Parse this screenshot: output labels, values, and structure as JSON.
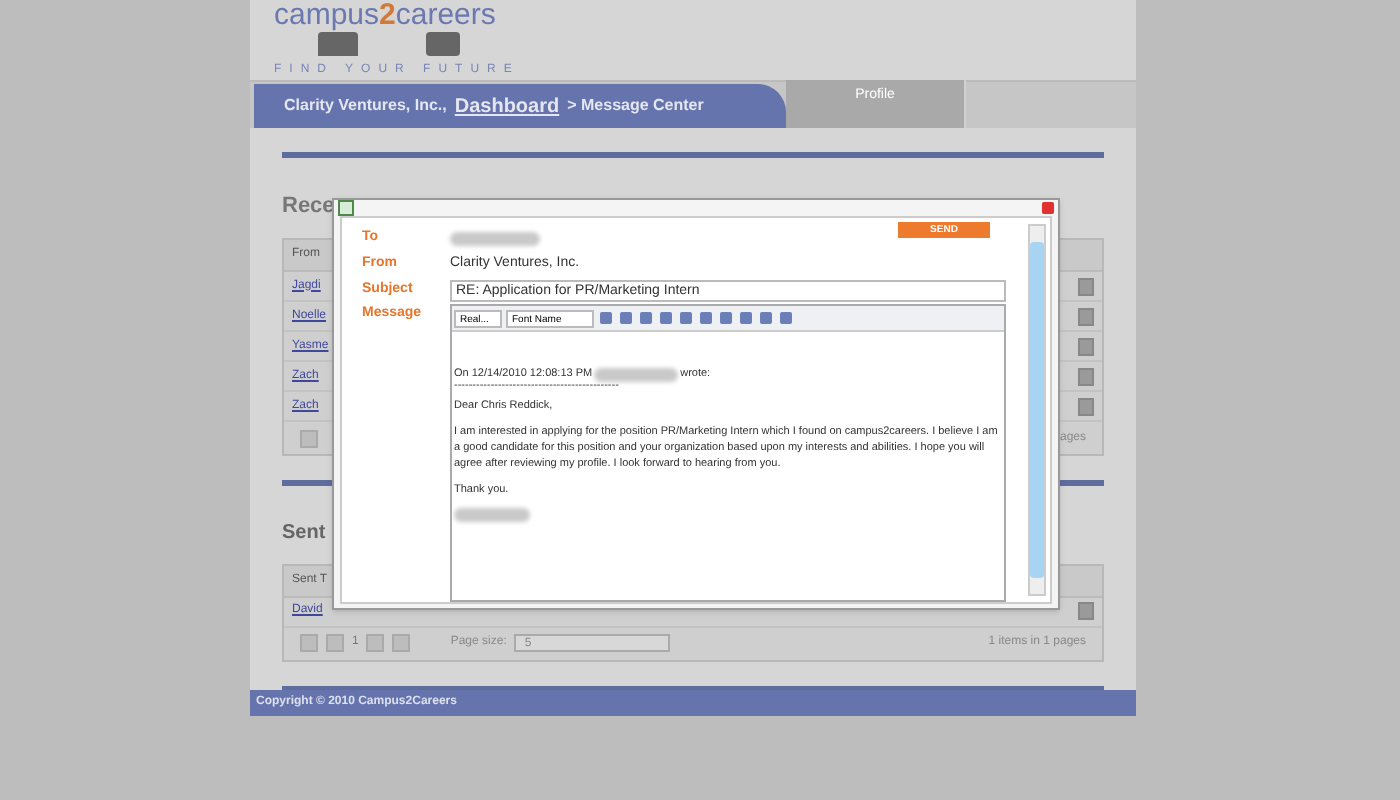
{
  "header": {
    "logo_left": "campus",
    "logo_mid": "2",
    "logo_right": "careers",
    "tagline": "FIND YOUR FUTURE"
  },
  "breadcrumb": {
    "company": "Clarity Ventures, Inc.,",
    "link": "Dashboard",
    "rest": "> Message Center"
  },
  "tabs": [
    {
      "label": "Profile",
      "selected": false
    }
  ],
  "received": {
    "heading": "Rece",
    "column": "From",
    "rows": [
      "Jagdi",
      "Noelle",
      "Yasme",
      "Zach",
      "Zach"
    ],
    "pager_tail": "ages"
  },
  "sent": {
    "heading": "Sent",
    "column": "Sent T",
    "rows": [
      "David"
    ],
    "page": "1",
    "page_size_label": "Page size:",
    "page_size": "5",
    "summary": "1 items in 1 pages"
  },
  "footer": "Copyright © 2010 Campus2Careers",
  "dialog": {
    "send": "SEND",
    "fields": [
      {
        "label": "To",
        "kind": "blurred"
      },
      {
        "label": "From",
        "kind": "text",
        "value": "Clarity Ventures, Inc."
      },
      {
        "label": "Subject",
        "kind": "input",
        "value": "RE: Application for PR/Marketing Intern"
      },
      {
        "label": "Message",
        "kind": "editor"
      }
    ],
    "toolbar": {
      "size": "Real...",
      "font": "Font Name"
    },
    "body": [
      {
        "kind": "blank"
      },
      {
        "kind": "quote",
        "text": "On 12/14/2010 12:08:13 PM",
        "tail": "wrote:"
      },
      {
        "kind": "rule",
        "text": "---------------------------------------------"
      },
      {
        "kind": "para",
        "text": "Dear Chris Reddick,"
      },
      {
        "kind": "para",
        "text": "I am interested in applying for the position PR/Marketing Intern which I found on campus2careers. I believe I am a good candidate for this position and your organization based upon my interests and abilities. I hope you will agree after reviewing my profile. I look forward to hearing from you."
      },
      {
        "kind": "para",
        "text": "Thank you."
      },
      {
        "kind": "signature"
      }
    ]
  }
}
